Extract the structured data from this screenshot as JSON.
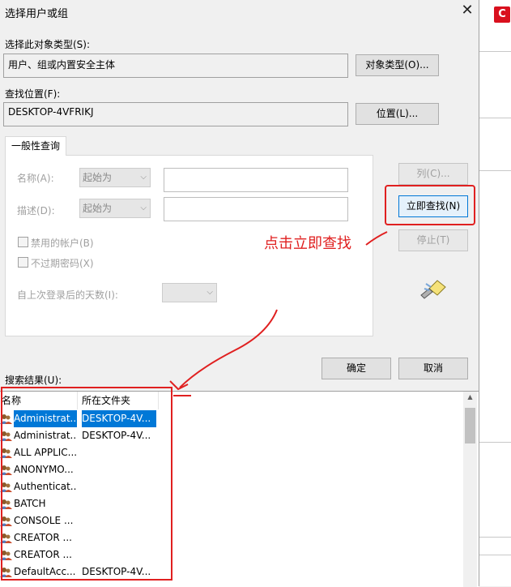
{
  "dialog": {
    "title": "选择用户或组",
    "object_type_label": "选择此对象类型(S):",
    "object_type_value": "用户、组或内置安全主体",
    "object_type_button": "对象类型(O)...",
    "location_label": "查找位置(F):",
    "location_value": "DESKTOP-4VFRIKJ",
    "location_button": "位置(L)...",
    "tab_label": "一般性查询",
    "name_label": "名称(A):",
    "name_mode": "起始为",
    "desc_label": "描述(D):",
    "desc_mode": "起始为",
    "disabled_accounts": "禁用的帐户(B)",
    "non_expiring": "不过期密码(X)",
    "days_label": "自上次登录后的天数(I):",
    "columns_button": "列(C)...",
    "find_now_button": "立即查找(N)",
    "stop_button": "停止(T)",
    "ok_button": "确定",
    "cancel_button": "取消",
    "results_label": "搜索结果(U):"
  },
  "results": {
    "headers": [
      "名称",
      "所在文件夹"
    ],
    "rows": [
      {
        "name": "Administrat...",
        "folder": "DESKTOP-4V..."
      },
      {
        "name": "Administrat...",
        "folder": "DESKTOP-4V..."
      },
      {
        "name": "ALL APPLIC...",
        "folder": ""
      },
      {
        "name": "ANONYMO...",
        "folder": ""
      },
      {
        "name": "Authenticat...",
        "folder": ""
      },
      {
        "name": "BATCH",
        "folder": ""
      },
      {
        "name": "CONSOLE ...",
        "folder": ""
      },
      {
        "name": "CREATOR ...",
        "folder": ""
      },
      {
        "name": "CREATOR ...",
        "folder": ""
      },
      {
        "name": "DefaultAcc...",
        "folder": "DESKTOP-4V..."
      }
    ]
  },
  "annotation": {
    "text": "点击立即查找",
    "color": "#e02020"
  },
  "icons": {
    "search_icon": "flashlight-search-icon",
    "user_icon": "user-group-icon"
  },
  "colors": {
    "selection": "#0078d7",
    "annotation": "#e02020"
  }
}
